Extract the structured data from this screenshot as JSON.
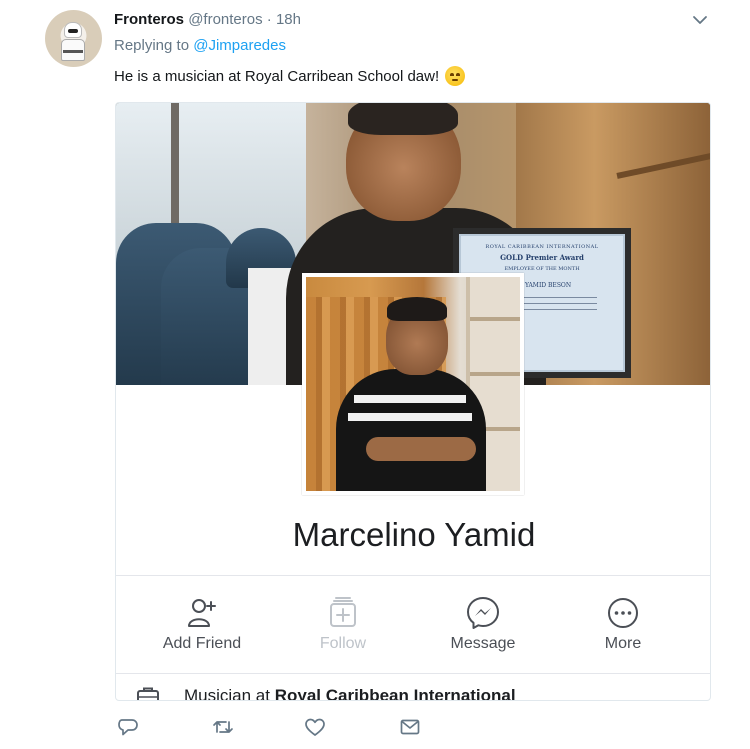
{
  "tweet": {
    "author_name": "Fronteros",
    "author_handle": "@fronteros",
    "separator": "·",
    "time": "18h",
    "replying_prefix": "Replying to",
    "replying_to": "@Jimparedes",
    "text": "He is a musician at Royal Carribean School daw!",
    "emoji": "rolling-eyes-face"
  },
  "card": {
    "certificate": {
      "top": "ROYAL CARIBBEAN INTERNATIONAL",
      "title": "GOLD Premier Award",
      "subtitle": "EMPLOYEE OF THE MONTH",
      "name": "NO YAMID BESON"
    },
    "profile_name": "Marcelino Yamid",
    "actions": [
      {
        "label": "Add Friend",
        "icon": "add-friend-icon",
        "enabled": true
      },
      {
        "label": "Follow",
        "icon": "follow-icon",
        "enabled": false
      },
      {
        "label": "Message",
        "icon": "messenger-icon",
        "enabled": true
      },
      {
        "label": "More",
        "icon": "more-icon",
        "enabled": true
      }
    ],
    "work": {
      "prefix": "Musician at",
      "employer": "Royal Caribbean International",
      "icon": "briefcase-icon"
    }
  },
  "tweet_actions": [
    {
      "icon": "reply-icon"
    },
    {
      "icon": "retweet-icon"
    },
    {
      "icon": "like-icon"
    },
    {
      "icon": "direct-message-icon"
    }
  ],
  "colors": {
    "link": "#1da1f2",
    "muted": "#657786",
    "text": "#14171a"
  }
}
